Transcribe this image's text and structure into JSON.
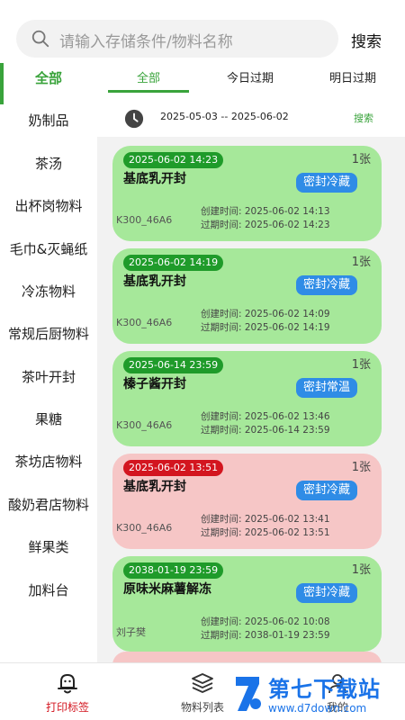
{
  "search": {
    "placeholder": "请输入存储条件/物料名称",
    "button_label": "搜索"
  },
  "sidebar": {
    "items": [
      {
        "label": "全部",
        "active": true
      },
      {
        "label": "奶制品"
      },
      {
        "label": "茶汤"
      },
      {
        "label": "出杯岗物料"
      },
      {
        "label": "毛巾&灭蝇纸"
      },
      {
        "label": "冷冻物料"
      },
      {
        "label": "常规后厨物料"
      },
      {
        "label": "茶叶开封"
      },
      {
        "label": "果糖"
      },
      {
        "label": "茶坊店物料"
      },
      {
        "label": "酸奶君店物料"
      },
      {
        "label": "鲜果类"
      },
      {
        "label": "加料台"
      }
    ]
  },
  "tabs": [
    {
      "label": "全部",
      "active": true
    },
    {
      "label": "今日过期"
    },
    {
      "label": "明日过期"
    }
  ],
  "date_filter": {
    "range": "2025-05-03 -- 2025-06-02",
    "search_label": "搜索",
    "icon": "clock-icon"
  },
  "cards": [
    {
      "status": "green",
      "count": "1张",
      "expire": "2025-06-02 14:23",
      "name": "基底乳开封",
      "storage": "密封冷藏",
      "creator": "K300_46A6",
      "created": "创建时间: 2025-06-02 14:13",
      "expires_line": "过期时间: 2025-06-02 14:23"
    },
    {
      "status": "green",
      "count": "1张",
      "expire": "2025-06-02 14:19",
      "name": "基底乳开封",
      "storage": "密封冷藏",
      "creator": "K300_46A6",
      "created": "创建时间: 2025-06-02 14:09",
      "expires_line": "过期时间: 2025-06-02 14:19"
    },
    {
      "status": "green",
      "count": "1张",
      "expire": "2025-06-14 23:59",
      "name": "榛子酱开封",
      "storage": "密封常温",
      "creator": "K300_46A6",
      "created": "创建时间: 2025-06-02 13:46",
      "expires_line": "过期时间: 2025-06-14 23:59"
    },
    {
      "status": "red",
      "count": "1张",
      "expire": "2025-06-02 13:51",
      "name": "基底乳开封",
      "storage": "密封冷藏",
      "creator": "K300_46A6",
      "created": "创建时间: 2025-06-02 13:41",
      "expires_line": "过期时间: 2025-06-02 13:51"
    },
    {
      "status": "green",
      "count": "1张",
      "expire": "2038-01-19 23:59",
      "name": "原味米麻薯解冻",
      "storage": "密封冷藏",
      "creator": "刘子樊",
      "created": "创建时间: 2025-06-02 10:08",
      "expires_line": "过期时间: 2038-01-19 23:59"
    }
  ],
  "bottom_nav": [
    {
      "label": "打印标签",
      "icon": "bell-icon",
      "active": true
    },
    {
      "label": "物料列表",
      "icon": "layers-icon"
    },
    {
      "label": "我的",
      "icon": "user-icon"
    }
  ],
  "watermark": {
    "title": "第七下载站",
    "url": "www.d7down.com"
  },
  "colors": {
    "accent_green": "#39a33b",
    "card_green": "#a6e89a",
    "card_red": "#f6c6c6",
    "badge_green": "#1f9b2a",
    "badge_red": "#d3151f",
    "tag_blue": "#2f8ce6"
  }
}
